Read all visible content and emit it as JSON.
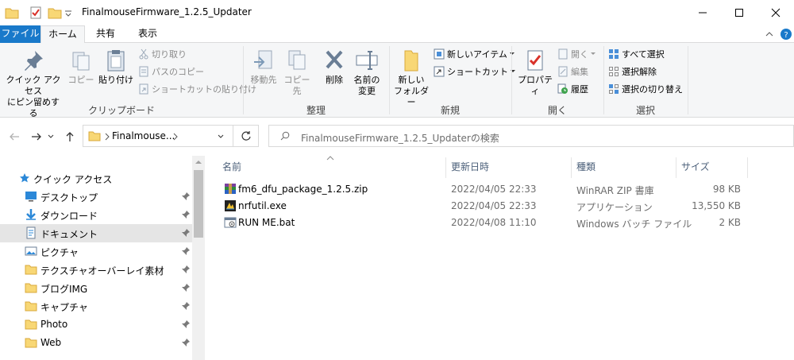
{
  "window": {
    "title": "FinalmouseFirmware_1.2.5_Updater"
  },
  "ribbon_tabs": [
    {
      "label": "ファイル"
    },
    {
      "label": "ホーム"
    },
    {
      "label": "共有"
    },
    {
      "label": "表示"
    }
  ],
  "ribbon": {
    "clipboard": {
      "pin_label_1": "クイック アクセス",
      "pin_label_2": "にピン留めする",
      "copy": "コピー",
      "paste": "貼り付け",
      "cut": "切り取り",
      "copy_path": "パスのコピー",
      "paste_shortcut": "ショートカットの貼り付け",
      "group": "クリップボード"
    },
    "organize": {
      "move_to": "移動先",
      "copy_to": "コピー先",
      "delete": "削除",
      "rename_1": "名前の",
      "rename_2": "変更",
      "group": "整理"
    },
    "new": {
      "new_folder_1": "新しい",
      "new_folder_2": "フォルダー",
      "new_item": "新しいアイテム",
      "shortcut": "ショートカット",
      "group": "新規"
    },
    "open": {
      "properties": "プロパティ",
      "open": "開く",
      "edit": "編集",
      "history": "履歴",
      "group": "開く"
    },
    "select": {
      "select_all": "すべて選択",
      "select_none": "選択解除",
      "invert": "選択の切り替え",
      "group": "選択"
    }
  },
  "address": {
    "path": "Finalmouse...",
    "search_placeholder": "FinalmouseFirmware_1.2.5_Updaterの検索"
  },
  "nav_pane": {
    "quick_access": "クイック アクセス",
    "items": [
      {
        "label": "デスクトップ",
        "icon": "desktop-icon"
      },
      {
        "label": "ダウンロード",
        "icon": "download-icon"
      },
      {
        "label": "ドキュメント",
        "icon": "documents-icon"
      },
      {
        "label": "ピクチャ",
        "icon": "pictures-icon"
      },
      {
        "label": "テクスチャオーバーレイ素材",
        "icon": "folder-icon"
      },
      {
        "label": "ブログIMG",
        "icon": "folder-icon"
      },
      {
        "label": "キャプチャ",
        "icon": "folder-icon"
      },
      {
        "label": "Photo",
        "icon": "folder-icon"
      },
      {
        "label": "Web",
        "icon": "folder-icon"
      }
    ]
  },
  "file_list": {
    "columns": {
      "name": "名前",
      "date": "更新日時",
      "type": "種類",
      "size": "サイズ"
    },
    "files": [
      {
        "name": "fm6_dfu_package_1.2.5.zip",
        "date": "2022/04/05 22:33",
        "type": "WinRAR ZIP 書庫",
        "size": "98 KB",
        "icon": "winrar-archive-icon"
      },
      {
        "name": "nrfutil.exe",
        "date": "2022/04/05 22:33",
        "type": "アプリケーション",
        "size": "13,550 KB",
        "icon": "exe-icon"
      },
      {
        "name": "RUN ME.bat",
        "date": "2022/04/08 11:10",
        "type": "Windows バッチ ファイル",
        "size": "2 KB",
        "icon": "batch-file-icon"
      }
    ]
  },
  "colors": {
    "file_tab": "#1979ca",
    "folder_yellow": "#f8d775",
    "ribbon_bg": "#f5f6f7",
    "selected_nav": "#e5e5e5"
  }
}
